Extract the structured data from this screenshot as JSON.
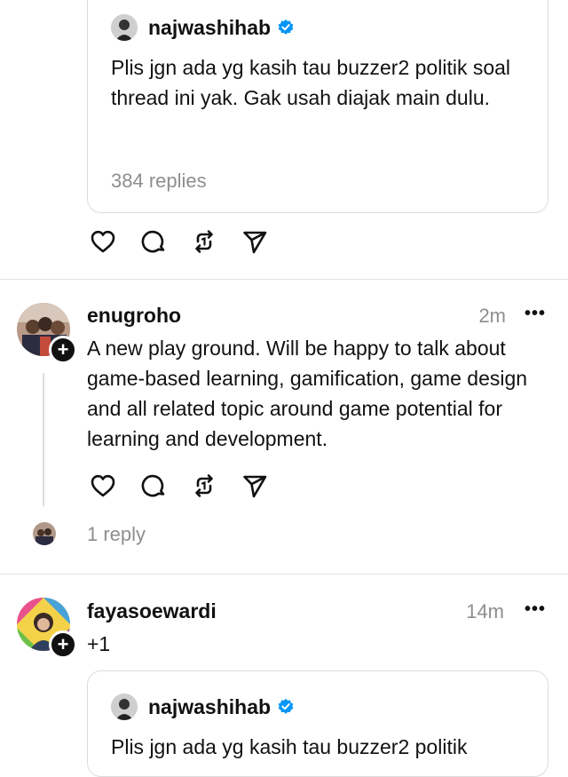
{
  "quote1": {
    "username": "najwashihab",
    "text": "Plis jgn ada yg kasih tau buzzer2 politik soal thread ini yak. Gak usah diajak main dulu.",
    "replies": "384 replies"
  },
  "post1": {
    "username": "enugroho",
    "time": "2m",
    "more": "•••",
    "plus": "+",
    "text": "A new play ground. Will be happy to talk about game-based learning, gamification, game design and all related topic around game potential for learning and development.",
    "reply_count": "1 reply"
  },
  "post2": {
    "username": "fayasoewardi",
    "time": "14m",
    "more": "•••",
    "plus": "+",
    "text": "+1"
  },
  "quote2": {
    "username": "najwashihab",
    "text": "Plis jgn ada yg kasih tau buzzer2 politik"
  },
  "icons": {
    "like": "heart-icon",
    "comment": "comment-icon",
    "repost": "repost-icon",
    "share": "share-icon",
    "verified": "verified-badge-icon"
  },
  "colors": {
    "verified": "#0095f6",
    "secondary_text": "#8e8e8e"
  }
}
